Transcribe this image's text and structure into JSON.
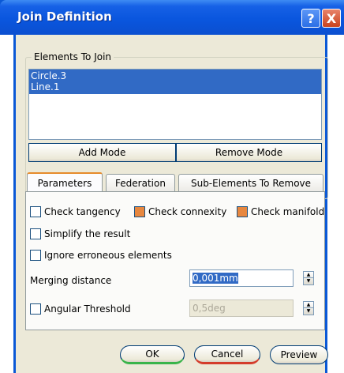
{
  "window": {
    "title": "Join Definition",
    "help_label": "?",
    "close_label": "X"
  },
  "elements_group": {
    "legend": "Elements To Join",
    "items": [
      "Circle.3",
      "Line.1"
    ],
    "add_mode_label": "Add Mode",
    "remove_mode_label": "Remove Mode"
  },
  "tabs": [
    {
      "label": "Parameters",
      "active": true
    },
    {
      "label": "Federation",
      "active": false
    },
    {
      "label": "Sub-Elements To Remove",
      "active": false
    }
  ],
  "parameters": {
    "check_tangency": {
      "label": "Check tangency",
      "checked": false
    },
    "check_connexity": {
      "label": "Check connexity",
      "checked": true
    },
    "check_manifold": {
      "label": "Check manifold",
      "checked": true
    },
    "simplify": {
      "label": "Simplify the result",
      "checked": false
    },
    "ignore_errors": {
      "label": "Ignore erroneous elements",
      "checked": false
    },
    "merging_distance": {
      "label": "Merging distance",
      "value": "0,001mm"
    },
    "angular_threshold": {
      "label": "Angular Threshold",
      "checked": false,
      "value": "0,5deg"
    }
  },
  "buttons": {
    "ok": "OK",
    "cancel": "Cancel",
    "preview": "Preview"
  },
  "colors": {
    "title_bar": "#0a56de",
    "selection": "#316ac5",
    "checked_box": "#e7873f",
    "dialog_bg": "#ece9d8"
  }
}
